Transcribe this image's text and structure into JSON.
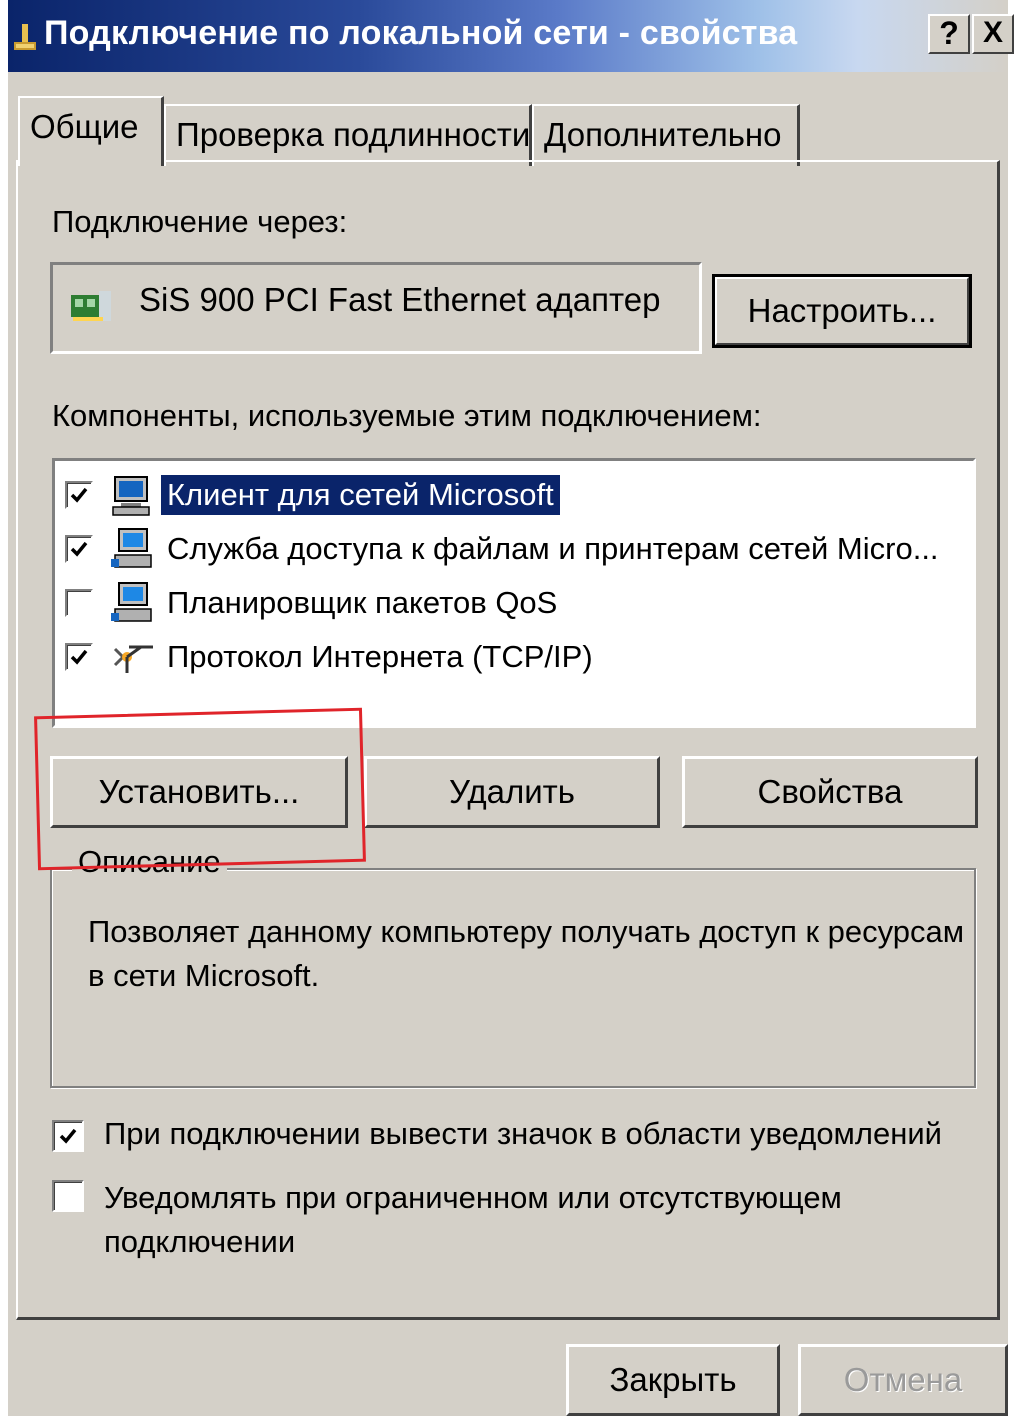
{
  "window": {
    "title": "Подключение по локальной сети - свойства",
    "help_button": "?",
    "close_button": "X"
  },
  "tabs": [
    {
      "label": "Общие",
      "active": true
    },
    {
      "label": "Проверка подлинности",
      "active": false
    },
    {
      "label": "Дополнительно",
      "active": false
    }
  ],
  "general": {
    "connect_using_label": "Подключение через:",
    "adapter_name": "SiS 900 PCI Fast Ethernet адаптер",
    "configure_button": "Настроить...",
    "components_label": "Компоненты, используемые этим подключением:",
    "components": [
      {
        "label": "Клиент для сетей Microsoft",
        "checked": true,
        "selected": true,
        "icon": "network-client-icon"
      },
      {
        "label": "Служба доступа к файлам и принтерам сетей Micro...",
        "checked": true,
        "selected": false,
        "icon": "network-service-icon"
      },
      {
        "label": "Планировщик пакетов QoS",
        "checked": false,
        "selected": false,
        "icon": "network-service-icon"
      },
      {
        "label": "Протокол Интернета (TCP/IP)",
        "checked": true,
        "selected": false,
        "icon": "protocol-icon"
      }
    ],
    "install_button": "Установить...",
    "remove_button": "Удалить",
    "properties_button": "Свойства",
    "description_title": "Описание",
    "description_text": "Позволяет данному компьютеру получать доступ к ресурсам в сети Microsoft.",
    "show_icon_label": "При подключении вывести значок в области уведомлений",
    "show_icon_checked": true,
    "notify_label": "Уведомлять при ограниченном или отсутствующем подключении",
    "notify_checked": false
  },
  "footer": {
    "close_button": "Закрыть",
    "cancel_button": "Отмена",
    "cancel_disabled": true
  },
  "colors": {
    "title_gradient_start": "#0a246a",
    "face": "#d4d0c8",
    "selection": "#0a246a",
    "highlight_annotation": "#e0242a"
  }
}
